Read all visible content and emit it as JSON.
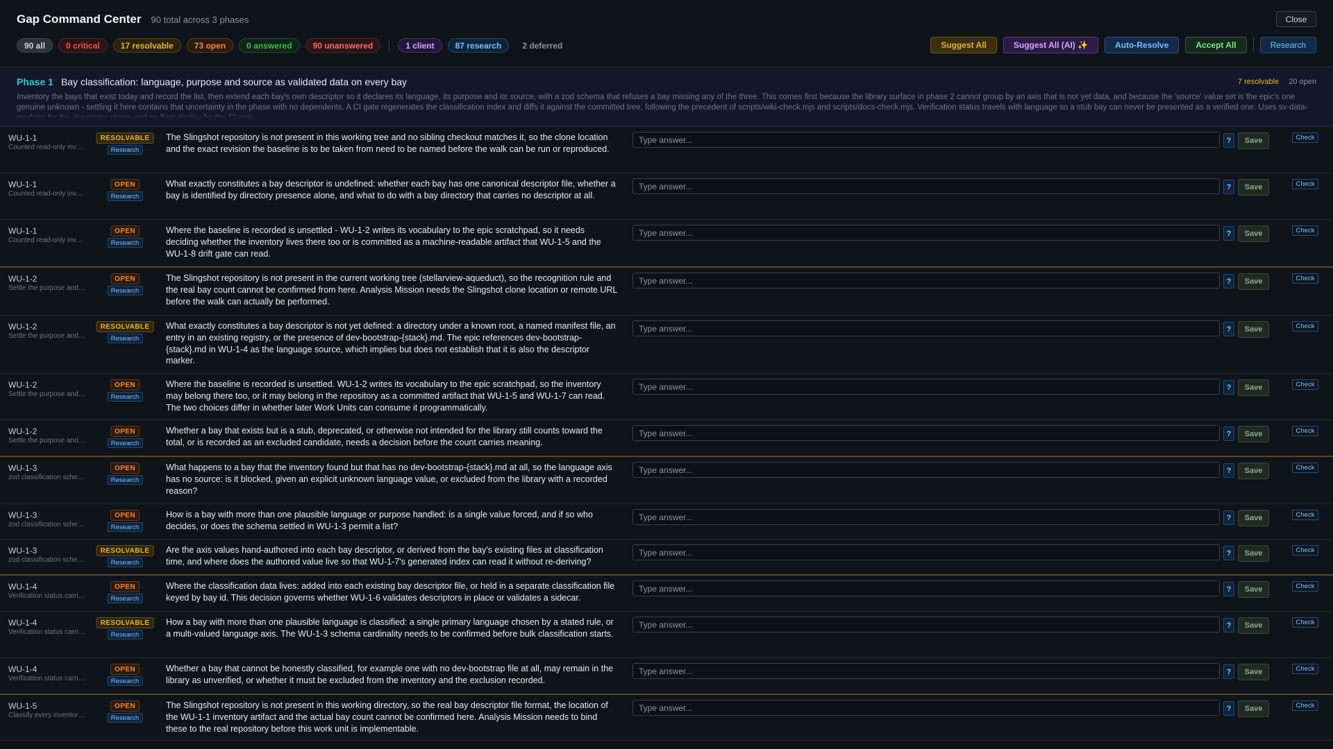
{
  "header": {
    "title": "Gap Command Center",
    "subtitle": "90 total across 3 phases",
    "close_label": "Close"
  },
  "filters": {
    "all": "90 all",
    "critical": "0 critical",
    "resolvable": "17 resolvable",
    "open": "73 open",
    "answered": "0 answered",
    "unanswered": "90 unanswered",
    "client": "1 client",
    "research": "87 research",
    "deferred": "2 deferred"
  },
  "actions": {
    "suggest_all": "Suggest All",
    "suggest_all_ai": "Suggest All (AI) ✨",
    "auto_resolve": "Auto-Resolve",
    "accept_all": "Accept All",
    "research": "Research"
  },
  "phase": {
    "label": "Phase 1",
    "title": "Bay classification: language, purpose and source as validated data on every bay",
    "resolvable": "7 resolvable",
    "open": "20 open",
    "description": "Inventory the bays that exist today and record the list, then extend each bay's own descriptor so it declares its language, its purpose and its source, with a zod schema that refuses a bay missing any of the three. This comes first because the library surface in phase 2 cannot group by an axis that is not yet data, and because the 'source' value set is the epic's one genuine unknown - settling it here contains that uncertainty in the phase with no dependents. A CI gate regenerates the classification index and diffs it against the committed tree, following the precedent of scripts/wiki-check.mjs and scripts/docs-check.mjs. Verification status travels with language so a stub bay can never be presented as a verified one. Uses sv-data-modeler for the descriptor shape and sv-fleet-deploy for the CI gate."
  },
  "row_labels": {
    "placeholder": "Type answer...",
    "help": "?",
    "save": "Save",
    "check": "Check",
    "research": "Research"
  },
  "rows": [
    {
      "wu": "WU-1-1",
      "sub": "Counted read-only inventory",
      "status": "RESOLVABLE",
      "question": "The Slingshot repository is not present in this working tree and no sibling checkout matches it, so the clone location and the exact revision the baseline is to be taken from need to be named before the walk can be run or reproduced."
    },
    {
      "wu": "WU-1-1",
      "sub": "Counted read-only inventory",
      "status": "OPEN",
      "question": "What exactly constitutes a bay descriptor is undefined: whether each bay has one canonical descriptor file, whether a bay is identified by directory presence alone, and what to do with a bay directory that carries no descriptor at all."
    },
    {
      "wu": "WU-1-1",
      "sub": "Counted read-only inventory",
      "status": "OPEN",
      "question": "Where the baseline is recorded is unsettled - WU-1-2 writes its vocabulary to the epic scratchpad, so it needs deciding whether the inventory lives there too or is committed as a machine-readable artifact that WU-1-5 and the WU-1-8 drift gate can read."
    },
    {
      "wu": "WU-1-2",
      "sub": "Settle the purpose and source values",
      "status": "OPEN",
      "question": "The Slingshot repository is not present in the current working tree (stellarview-aqueduct), so the recognition rule and the real bay count cannot be confirmed from here. Analysis Mission needs the Slingshot clone location or remote URL before the walk can actually be performed."
    },
    {
      "wu": "WU-1-2",
      "sub": "Settle the purpose and source values",
      "status": "RESOLVABLE",
      "question": "What exactly constitutes a bay descriptor is not yet defined: a directory under a known root, a named manifest file, an entry in an existing registry, or the presence of dev-bootstrap-{stack}.md. The epic references dev-bootstrap-{stack}.md in WU-1-4 as the language source, which implies but does not establish that it is also the descriptor marker."
    },
    {
      "wu": "WU-1-2",
      "sub": "Settle the purpose and source values",
      "status": "OPEN",
      "question": "Where the baseline is recorded is unsettled. WU-1-2 writes its vocabulary to the epic scratchpad, so the inventory may belong there too, or it may belong in the repository as a committed artifact that WU-1-5 and WU-1-7 can read. The two choices differ in whether later Work Units can consume it programmatically."
    },
    {
      "wu": "WU-1-2",
      "sub": "Settle the purpose and source values",
      "status": "OPEN",
      "question": "Whether a bay that exists but is a stub, deprecated, or otherwise not intended for the library still counts toward the total, or is recorded as an excluded candidate, needs a decision before the count carries meaning."
    },
    {
      "wu": "WU-1-3",
      "sub": "zod classification schema",
      "status": "OPEN",
      "question": "What happens to a bay that the inventory found but that has no dev-bootstrap-{stack}.md at all, so the language axis has no source: is it blocked, given an explicit unknown language value, or excluded from the library with a recorded reason?"
    },
    {
      "wu": "WU-1-3",
      "sub": "zod classification schema",
      "status": "OPEN",
      "question": "How is a bay with more than one plausible language or purpose handled: is a single value forced, and if so who decides, or does the schema settled in WU-1-3 permit a list?"
    },
    {
      "wu": "WU-1-3",
      "sub": "zod classification schema",
      "status": "RESOLVABLE",
      "question": "Are the axis values hand-authored into each bay descriptor, or derived from the bay's existing files at classification time, and where does the authored value live so that WU-1-7's generated index can read it without re-deriving?"
    },
    {
      "wu": "WU-1-4",
      "sub": "Verification status carried with language",
      "status": "OPEN",
      "question": "Where the classification data lives: added into each existing bay descriptor file, or held in a separate classification file keyed by bay id. This decision governs whether WU-1-6 validates descriptors in place or validates a sidecar."
    },
    {
      "wu": "WU-1-4",
      "sub": "Verification status carried with language",
      "status": "RESOLVABLE",
      "question": "How a bay with more than one plausible language is classified: a single primary language chosen by a stated rule, or a multi-valued language axis. The WU-1-3 schema cardinality needs to be confirmed before bulk classification starts."
    },
    {
      "wu": "WU-1-4",
      "sub": "Verification status carried with language",
      "status": "OPEN",
      "question": "Whether a bay that cannot be honestly classified, for example one with no dev-bootstrap file at all, may remain in the library as unverified, or whether it must be excluded from the inventory and the exclusion recorded."
    },
    {
      "wu": "WU-1-5",
      "sub": "Classify every inventoried bay",
      "status": "OPEN",
      "question": "The Slingshot repository is not present in this working directory, so the real bay descriptor file format, the location of the WU-1-1 inventory artifact and the actual bay count cannot be confirmed here. Analysis Mission needs to bind these to the real repository before this work unit is implementable."
    }
  ]
}
